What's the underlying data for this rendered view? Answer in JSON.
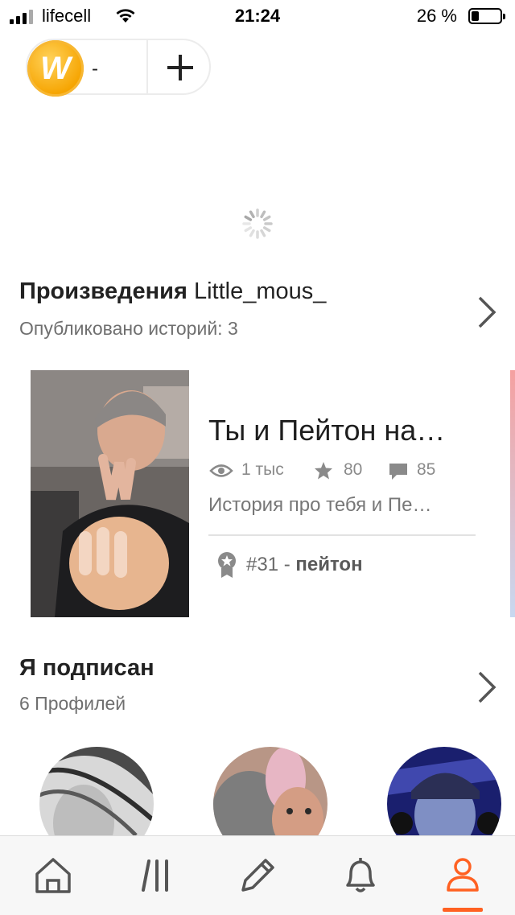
{
  "status_bar": {
    "carrier": "lifecell",
    "time": "21:24",
    "battery_percent": "26 %",
    "battery_level": 0.26
  },
  "coins": {
    "logo_letter": "W",
    "count": "-",
    "add_icon": "plus-icon"
  },
  "works_section": {
    "title": "Произведения",
    "username": "Little_mous_",
    "subtitle": "Опубликовано историй: 3"
  },
  "story": {
    "title": "Ты и Пейтон на…",
    "reads": "1 тыс",
    "votes": "80",
    "comments": "85",
    "description": "История про тебя и Пе…",
    "rank": "#31 -",
    "rank_tag": "пейтон"
  },
  "following_section": {
    "title": "Я подписан",
    "subtitle": "6 Профилей"
  },
  "tab_bar": {
    "items": [
      {
        "icon": "home-icon"
      },
      {
        "icon": "library-icon"
      },
      {
        "icon": "pencil-icon"
      },
      {
        "icon": "bell-icon"
      },
      {
        "icon": "profile-icon",
        "active": true
      }
    ],
    "active_color": "#ff6122"
  }
}
